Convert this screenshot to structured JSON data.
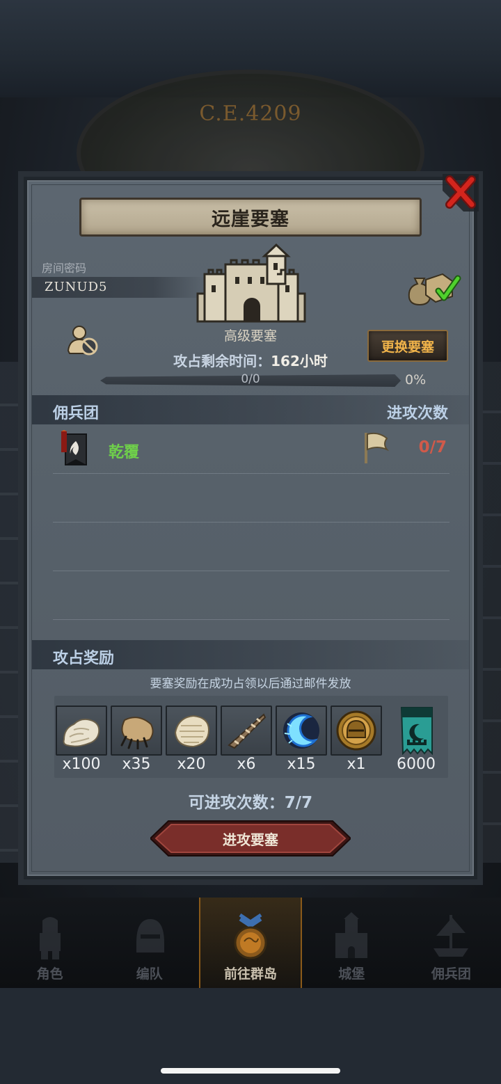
{
  "background": {
    "era_label": "C.E.4209"
  },
  "modal": {
    "title": "远崖要塞",
    "room_code_label": "房间密码",
    "room_code": "ZUNUD5",
    "fortress_grade": "高级要塞",
    "change_fortress_label": "更换要塞",
    "time_left_label": "攻占剩余时间：",
    "time_left_value": "162小时",
    "progress": {
      "text": "0/0",
      "percent_label": "0%",
      "fraction": 0
    },
    "mercenary_section": {
      "header": "佣兵团",
      "attack_count_header": "进攻次数",
      "rows": [
        {
          "name": "乾覆",
          "attempts": "0/7",
          "name_color": "#6fd04a",
          "attempts_color": "#d05a4a"
        }
      ]
    },
    "reward_section": {
      "header": "攻占奖励",
      "note": "要塞奖励在成功占领以后通过邮件发放",
      "items": [
        {
          "icon": "white-fur-icon",
          "count": "x100"
        },
        {
          "icon": "beast-claw-icon",
          "count": "x35"
        },
        {
          "icon": "fur-pelt-icon",
          "count": "x20"
        },
        {
          "icon": "spiral-horn-icon",
          "count": "x6"
        },
        {
          "icon": "blue-crescent-icon",
          "count": "x15"
        },
        {
          "icon": "golden-helmet-icon",
          "count": "x1"
        },
        {
          "icon": "teal-banner-icon",
          "count": "6000"
        }
      ]
    },
    "attacks_available_label": "可进攻次数：7/7",
    "attack_button_label": "进攻要塞"
  },
  "bottom_nav": {
    "items": [
      {
        "label": "角色",
        "icon": "knight-icon",
        "active": false
      },
      {
        "label": "编队",
        "icon": "helmet-icon",
        "active": false
      },
      {
        "label": "前往群岛",
        "icon": "compass-map-icon",
        "active": true
      },
      {
        "label": "城堡",
        "icon": "castle-icon",
        "active": false
      },
      {
        "label": "佣兵团",
        "icon": "ship-icon",
        "active": false
      }
    ]
  },
  "colors": {
    "accent_gold": "#f0b34a",
    "section_header": "#bcd0e6",
    "attack_button": "#7a2e2a"
  }
}
